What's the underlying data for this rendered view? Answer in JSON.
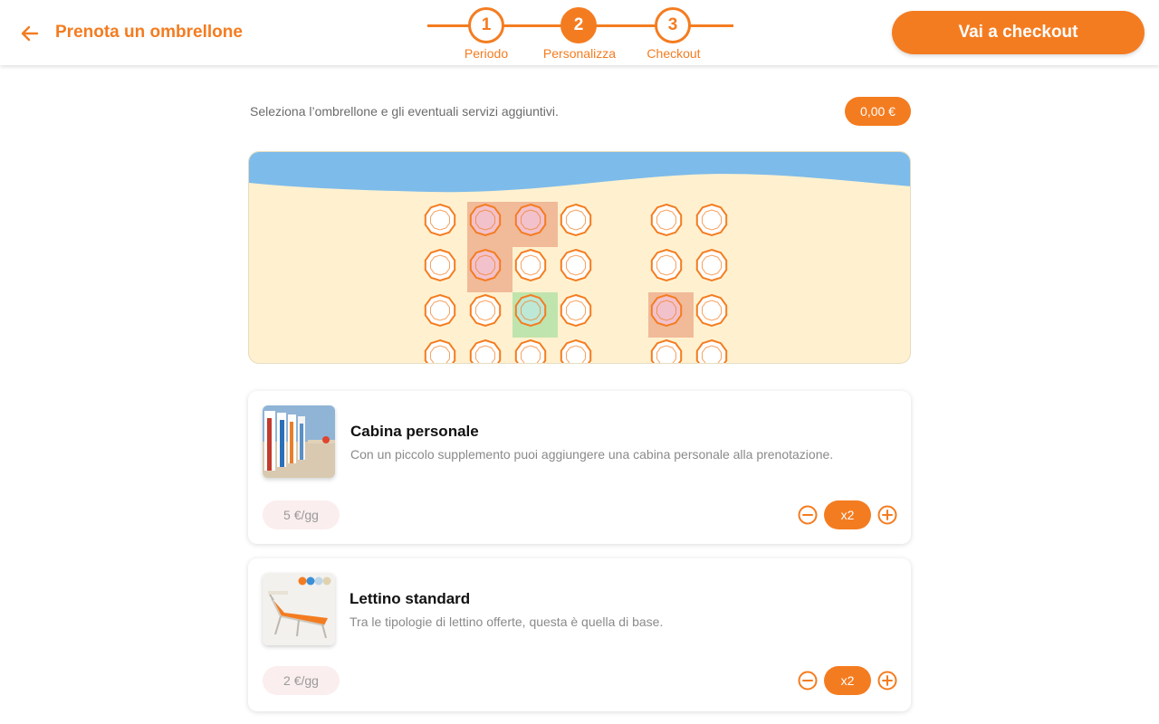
{
  "header": {
    "title": "Prenota un ombrellone",
    "checkout_label": "Vai a checkout",
    "steps": [
      {
        "number": "1",
        "label": "Periodo",
        "active": false
      },
      {
        "number": "2",
        "label": "Personalizza",
        "active": true
      },
      {
        "number": "3",
        "label": "Checkout",
        "active": false
      }
    ]
  },
  "intro": {
    "text": "Seleziona l’ombrellone e gli eventuali servizi aggiuntivi.",
    "total": "0,00 €"
  },
  "beach_map": {
    "sea_color": "#7dbbea",
    "sand_color": "#fff1cf",
    "umbrella_color": "#f47c20",
    "rows": [
      [
        "free",
        "occupied",
        "occupied",
        "free",
        "gap",
        "free",
        "free"
      ],
      [
        "free",
        "occupied",
        "free",
        "free",
        "gap",
        "free",
        "free"
      ],
      [
        "free",
        "free",
        "selected",
        "free",
        "gap",
        "occupied",
        "free"
      ],
      [
        "free",
        "free",
        "free",
        "free",
        "gap",
        "free",
        "free"
      ]
    ]
  },
  "services": [
    {
      "title": "Cabina personale",
      "description": "Con un piccolo supplemento puoi aggiungere una cabina personale alla prenotazione.",
      "price": "5 €/gg",
      "quantity": "x2",
      "image": "beach-cabins-photo"
    },
    {
      "title": "Lettino standard",
      "description": "Tra le tipologie di lettino offerte, questa è quella di base.",
      "price": "2 €/gg",
      "quantity": "x2",
      "image": "sunbed-photo"
    }
  ],
  "colors": {
    "accent": "#f47c20",
    "occupied": "#e68c6e",
    "selected": "#96dc96"
  }
}
